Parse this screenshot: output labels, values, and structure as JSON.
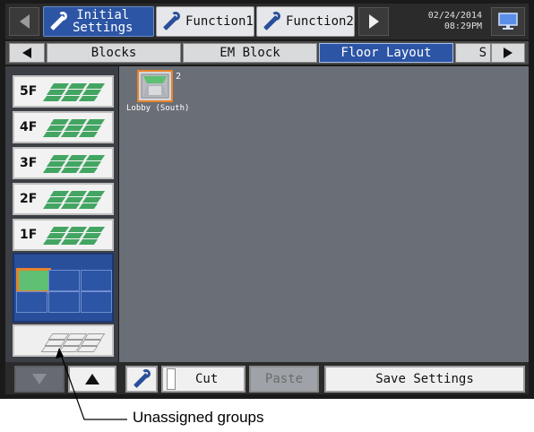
{
  "topbar": {
    "tab_initial_line1": "Initial",
    "tab_initial_line2": "Settings",
    "tab_function1": "Function1",
    "tab_function2": "Function2",
    "date": "02/24/2014",
    "time": "08:29PM"
  },
  "subtabs": {
    "blocks": "Blocks",
    "em_block": "EM Block",
    "floor_layout": "Floor Layout",
    "next_partial": "S"
  },
  "floors": [
    {
      "label": "5F"
    },
    {
      "label": "4F"
    },
    {
      "label": "3F"
    },
    {
      "label": "2F"
    },
    {
      "label": "1F"
    }
  ],
  "layout_unit": {
    "number": "2",
    "label": "Lobby (South)"
  },
  "bottombar": {
    "cut": "Cut",
    "paste": "Paste",
    "save_settings": "Save Settings"
  },
  "callout": {
    "text": "Unassigned groups"
  },
  "colors": {
    "accent": "#2d55a5",
    "floor_tile": "#43a562",
    "unit_highlight": "#e8832a",
    "screen_bg": "#6a6f77"
  }
}
